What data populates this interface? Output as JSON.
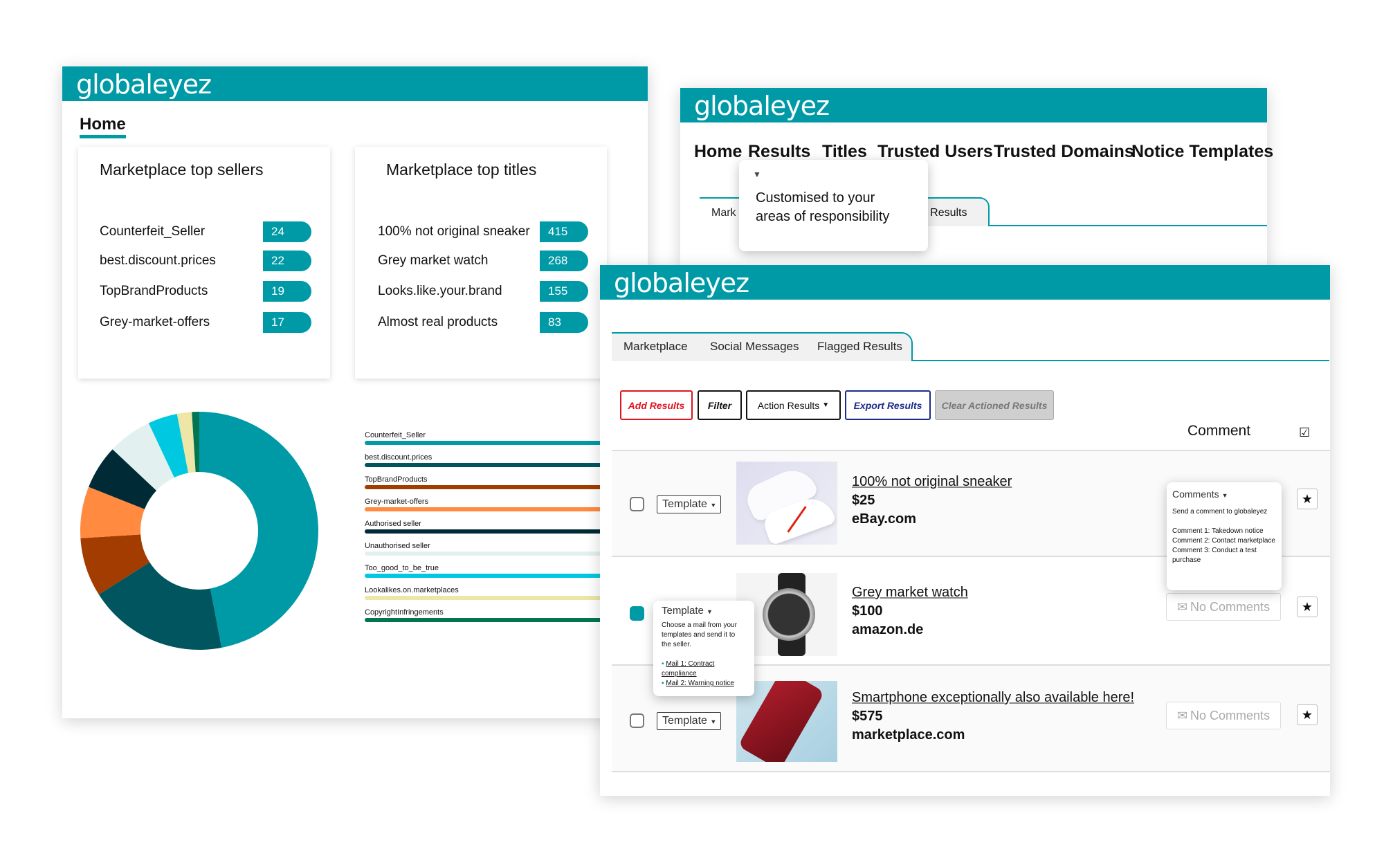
{
  "brand": {
    "logo": "globaleyez",
    "accent": "#009aa6"
  },
  "home_panel": {
    "nav_home": "Home",
    "top_sellers": {
      "title": "Marketplace top sellers",
      "items": [
        {
          "name": "Counterfeit_Seller",
          "count": "24"
        },
        {
          "name": "best.discount.prices",
          "count": "22"
        },
        {
          "name": "TopBrandProducts",
          "count": "19"
        },
        {
          "name": "Grey-market-offers",
          "count": "17"
        }
      ]
    },
    "top_titles": {
      "title": "Marketplace top titles",
      "items": [
        {
          "name": "100% not original sneaker",
          "count": "415"
        },
        {
          "name": "Grey market watch",
          "count": "268"
        },
        {
          "name": "Looks.like.your.brand",
          "count": "155"
        },
        {
          "name": "Almost real products",
          "count": "83"
        }
      ]
    }
  },
  "chart_data": {
    "type": "pie",
    "donut": true,
    "categories": [
      "Counterfeit_Seller",
      "best.discount.prices",
      "TopBrandProducts",
      "Grey-market-offers",
      "Authorised seller",
      "Unauthorised seller",
      "Too_good_to_be_true",
      "Lookalikes.on.marketplaces",
      "CopyrightInfringements"
    ],
    "values": [
      47,
      19,
      8,
      7,
      6,
      6,
      4,
      2,
      1
    ],
    "colors": [
      "#009aa6",
      "#00555f",
      "#a33c00",
      "#ff8a40",
      "#002a35",
      "#e2f1ef",
      "#00c8e0",
      "#ede6a6",
      "#007550"
    ],
    "legend": "right"
  },
  "results_panel": {
    "nav": [
      "Home",
      "Results",
      "Titles",
      "Trusted Users",
      "Trusted Domains",
      "Notice Templates"
    ],
    "tabs_partial": {
      "left": "Mark",
      "right": "ged Results"
    },
    "tooltip": "Customised to your areas of responsibility"
  },
  "main_panel": {
    "tabs": [
      "Marketplace",
      "Social Messages",
      "Flagged Results"
    ],
    "buttons": {
      "add": "Add Results",
      "filter": "Filter",
      "action": "Action Results",
      "export": "Export Results",
      "clear": "Clear Actioned Results"
    },
    "comment_header": "Comment",
    "template_label": "Template",
    "no_comments": "No Comments",
    "rows": [
      {
        "title": "100% not original sneaker",
        "price": "$25",
        "site": "eBay.com",
        "checked": false
      },
      {
        "title": "Grey market watch",
        "price": "$100",
        "site": "amazon.de",
        "checked": true
      },
      {
        "title": "Smartphone exceptionally also available here!",
        "price": "$575",
        "site": "marketplace.com",
        "checked": false
      }
    ],
    "comments_popup": {
      "label": "Comments",
      "intro": "Send a comment to globaleyez",
      "items": [
        "Comment 1: Takedown notice",
        "Comment 2: Contact marketplace",
        "Comment 3: Conduct a test purchase"
      ]
    },
    "template_popup": {
      "label": "Template",
      "intro": "Choose a mail from your templates and send it to the seller.",
      "items": [
        "Mail 1: Contract compliance",
        "Mail 2: Warning notice"
      ]
    }
  }
}
